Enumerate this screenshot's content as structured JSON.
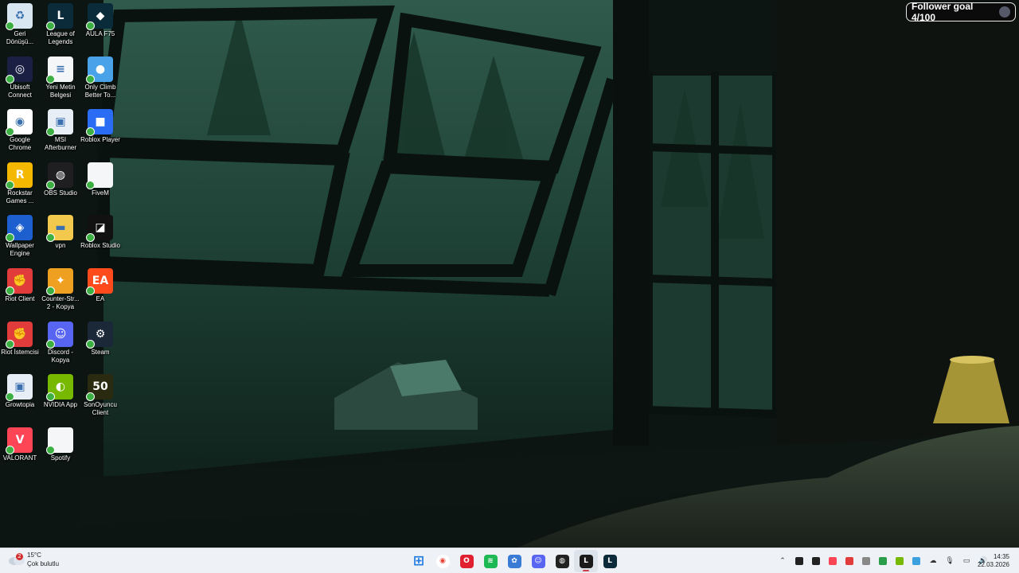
{
  "overlay": {
    "follower_goal": "Follower goal 4/100"
  },
  "desktop_icons": [
    {
      "label": "Geri Dönüşü...",
      "icon": "recycle-bin-icon",
      "color": "#d8e6f2"
    },
    {
      "label": "League of Legends",
      "icon": "league-icon",
      "color": "#0b2b3a"
    },
    {
      "label": "AULA F75",
      "icon": "aula-icon",
      "color": "#0a2b3a"
    },
    {
      "label": "Ubisoft Connect",
      "icon": "ubisoft-icon",
      "color": "#1c1f44"
    },
    {
      "label": "Yeni Metin Belgesi",
      "icon": "text-document-icon",
      "color": "#f4f6f8"
    },
    {
      "label": "Only Climb Better To...",
      "icon": "globe-icon",
      "color": "#4aa3e8"
    },
    {
      "label": "Google Chrome",
      "icon": "chrome-icon",
      "color": "#ffffff"
    },
    {
      "label": "MSI Afterburner",
      "icon": "app-window-icon",
      "color": "#e8eef5"
    },
    {
      "label": "Roblox Player",
      "icon": "roblox-icon",
      "color": "#2a6df4"
    },
    {
      "label": "Rockstar Games ...",
      "icon": "rockstar-icon",
      "color": "#f5b800"
    },
    {
      "label": "OBS Studio",
      "icon": "obs-icon",
      "color": "#1f1f22"
    },
    {
      "label": "FiveM",
      "icon": "blank-file-icon",
      "color": "#f4f6f8"
    },
    {
      "label": "Wallpaper Engine",
      "icon": "wallpaper-engine-icon",
      "color": "#1e5fd0"
    },
    {
      "label": "vpn",
      "icon": "folder-icon",
      "color": "#f2c94c"
    },
    {
      "label": "Roblox Studio",
      "icon": "roblox-studio-icon",
      "color": "#111111"
    },
    {
      "label": "Riot Client",
      "icon": "riot-icon",
      "color": "#e23b3b"
    },
    {
      "label": "Counter-Str... 2 - Kopya",
      "icon": "cs2-icon",
      "color": "#f0a020"
    },
    {
      "label": "EA",
      "icon": "ea-icon",
      "color": "#ff4a1c"
    },
    {
      "label": "Riot İstemcisi",
      "icon": "riot-icon",
      "color": "#e23b3b"
    },
    {
      "label": "Discord - Kopya",
      "icon": "discord-icon",
      "color": "#5865f2"
    },
    {
      "label": "Steam",
      "icon": "steam-icon",
      "color": "#1b2838"
    },
    {
      "label": "Growtopia",
      "icon": "app-window-icon",
      "color": "#e8eef5"
    },
    {
      "label": "NVIDIA App",
      "icon": "nvidia-icon",
      "color": "#76b900"
    },
    {
      "label": "SonOyuncu Client",
      "icon": "sonoyuncu-icon",
      "color": "#2a2a10"
    },
    {
      "label": "VALORANT",
      "icon": "valorant-icon",
      "color": "#fd4556"
    },
    {
      "label": "Spotify",
      "icon": "blank-file-icon",
      "color": "#f4f6f8"
    }
  ],
  "taskbar": {
    "weather": {
      "badge": "2",
      "temp": "15°C",
      "desc": "Çok bulutlu"
    },
    "apps": [
      {
        "name": "start",
        "icon": "windows-start-icon",
        "color": "#1f7ae0"
      },
      {
        "name": "chrome",
        "icon": "chrome-icon",
        "color": "#ffffff"
      },
      {
        "name": "opera",
        "icon": "opera-icon",
        "color": "#e02030"
      },
      {
        "name": "spotify",
        "icon": "spotify-icon",
        "color": "#1db954"
      },
      {
        "name": "wallpaper",
        "icon": "gear-app-icon",
        "color": "#3a7bd5"
      },
      {
        "name": "discord",
        "icon": "discord-icon",
        "color": "#5865f2"
      },
      {
        "name": "obs",
        "icon": "obs-icon",
        "color": "#222222"
      },
      {
        "name": "league-client",
        "icon": "league-icon",
        "color": "#1a1a1a"
      },
      {
        "name": "league",
        "icon": "league-icon",
        "color": "#0b2b3a"
      }
    ],
    "tray_icons": [
      "chevron-up-icon",
      "tray-app-icon",
      "tray-app-icon",
      "valorant-icon",
      "riot-icon",
      "tray-app-icon",
      "tray-app-icon",
      "nvidia-icon",
      "tray-app-icon",
      "cloud-icon",
      "microphone-icon",
      "network-icon",
      "volume-icon"
    ],
    "time": "14:35",
    "date": "22.03.2026"
  }
}
